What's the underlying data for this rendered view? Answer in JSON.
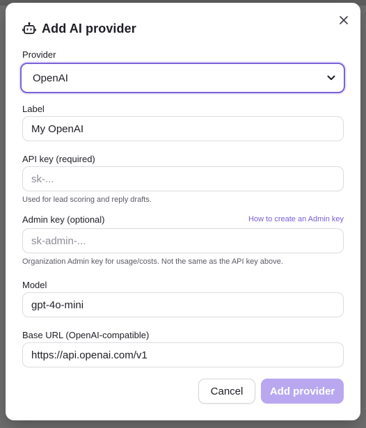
{
  "dialog": {
    "title": "Add AI provider",
    "icon": "robot-icon"
  },
  "provider": {
    "label": "Provider",
    "selected": "OpenAI"
  },
  "label_field": {
    "label": "Label",
    "value": "My OpenAI"
  },
  "api_key": {
    "label": "API key (required)",
    "placeholder": "sk-...",
    "hint": "Used for lead scoring and reply drafts."
  },
  "admin_key": {
    "label": "Admin key (optional)",
    "help_link": "How to create an Admin key",
    "placeholder": "sk-admin-...",
    "hint": "Organization Admin key for usage/costs. Not the same as the API key above."
  },
  "model": {
    "label": "Model",
    "value": "gpt-4o-mini"
  },
  "base_url": {
    "label": "Base URL (OpenAI-compatible)",
    "value": "https://api.openai.com/v1"
  },
  "actions": {
    "cancel": "Cancel",
    "submit": "Add provider"
  },
  "colors": {
    "accent": "#7b61d9",
    "submit_disabled": "#b9a8f0"
  }
}
